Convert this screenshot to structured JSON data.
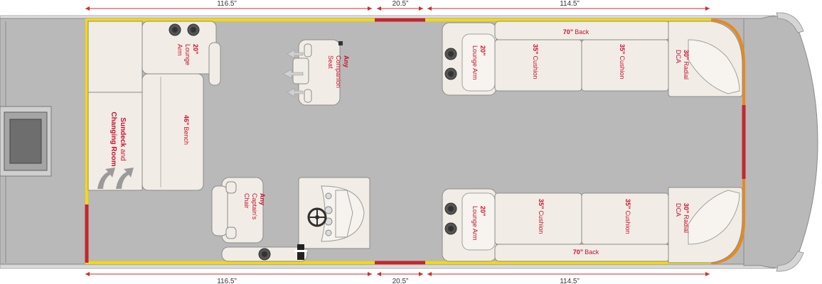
{
  "dimensions": {
    "top": [
      "116.5”",
      "20.5”",
      "114.5”"
    ],
    "bottom": [
      "116.5”",
      "20.5”",
      "114.5”"
    ]
  },
  "labels": {
    "sundeck_line1": "Sundeck",
    "sundeck_line2": "and",
    "sundeck_line3": "Changing Room",
    "lounge_arm_top_left": {
      "size": "20”",
      "line1": "Lounge",
      "line2": "Arm"
    },
    "bench": {
      "size": "46”",
      "name": "Bench"
    },
    "companion": {
      "size": "Any",
      "line1": "Companion",
      "line2": "Seat"
    },
    "captain": {
      "size": "Any",
      "line1": "Captain's",
      "line2": "Chair"
    },
    "lounge_arm_top_right": {
      "size": "20”",
      "name": "Lounge Arm"
    },
    "lounge_arm_bottom_right": {
      "size": "20”",
      "name": "Lounge Arm"
    },
    "back_top": {
      "size": "70”",
      "name": "Back"
    },
    "back_bottom": {
      "size": "70”",
      "name": "Back"
    },
    "cushion_top_1": {
      "size": "35”",
      "name": "Cushion"
    },
    "cushion_top_2": {
      "size": "35”",
      "name": "Cushion"
    },
    "cushion_bottom_1": {
      "size": "35”",
      "name": "Cushion"
    },
    "cushion_bottom_2": {
      "size": "35”",
      "name": "Cushion"
    },
    "dca_top": {
      "size": "30”",
      "line1": "Radial",
      "line2": "DCA"
    },
    "dca_bottom": {
      "size": "30”",
      "line1": "Radial",
      "line2": "DCA"
    }
  },
  "colors": {
    "deck": "#b9b9b9",
    "seat_fill": "#f1ede6",
    "seat_stroke": "#8c8c8c",
    "rail_yellow": "#f5d90a",
    "rail_red": "#c1272d",
    "rail_orange": "#e8891c",
    "label_red": "#c8102e",
    "dimension_red": "#d22b2b"
  }
}
